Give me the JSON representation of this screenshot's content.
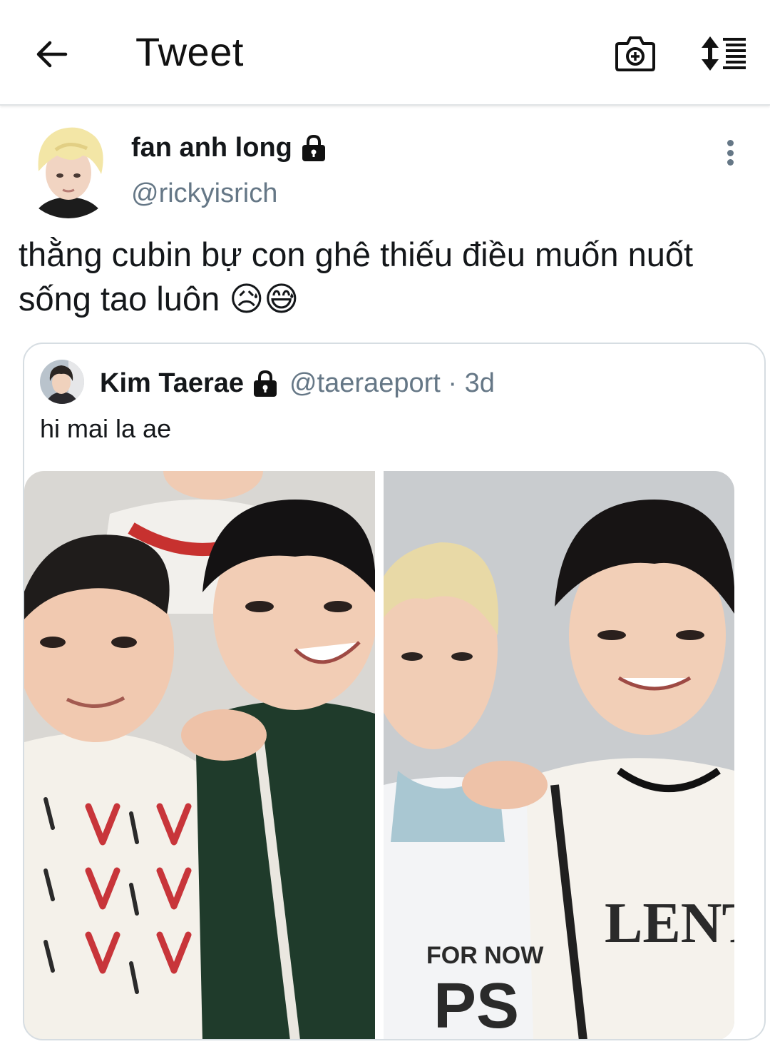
{
  "header": {
    "title": "Tweet",
    "back_icon": "arrow-left-icon",
    "camera_icon": "camera-add-icon",
    "sort_icon": "sort-list-icon"
  },
  "tweet": {
    "author_name": "fan anh long",
    "author_handle": "@rickyisrich",
    "text": "thằng cubin bự con ghê thiếu điều muốn nuốt sống tao luôn 😥😅",
    "protected": true
  },
  "quoted_tweet": {
    "author_name": "Kim Taerae",
    "author_handle": "@taeraeport",
    "separator": "·",
    "time": "3d",
    "protected": true,
    "text": "hi mai la ae",
    "photo_right_shirt_text_1": "FOR NOW",
    "photo_right_shirt_text_2": "PS",
    "photo_right_shirt_text_3": "LENTI"
  },
  "colors": {
    "text_primary": "#14171a",
    "text_secondary": "#657786",
    "border": "#d6dde2"
  }
}
